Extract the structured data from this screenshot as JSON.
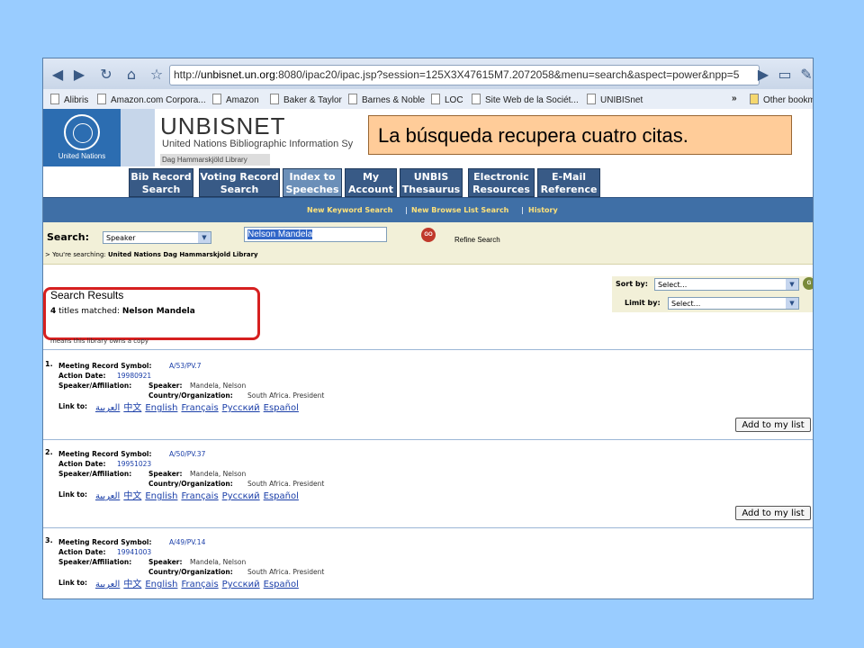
{
  "browser": {
    "url_prefix": "http://",
    "url_host": "unbisnet.un.org",
    "url_rest": ":8080/ipac20/ipac.jsp?session=125X3X47615M7.2072058&menu=search&aspect=power&npp=5",
    "bookmarks": [
      "Alibris",
      "Amazon.com Corpora...",
      "Amazon",
      "Baker & Taylor",
      "Barnes & Noble",
      "LOC",
      "Site Web de la Sociét...",
      "UNIBISnet",
      "Other bookm"
    ],
    "overflow": "»"
  },
  "header": {
    "un_label": "United Nations",
    "title": "UNBISNET",
    "subtitle": "United Nations Bibliographic Information Sy",
    "library": "Dag Hammarskjöld Library"
  },
  "overlay_caption": "La búsqueda recupera cuatro citas.",
  "tabs": [
    {
      "line1": "Bib Record",
      "line2": "Search"
    },
    {
      "line1": "Voting Record",
      "line2": "Search"
    },
    {
      "line1": "Index to",
      "line2": "Speeches"
    },
    {
      "line1": "My",
      "line2": "Account"
    },
    {
      "line1": "UNBIS",
      "line2": "Thesaurus"
    },
    {
      "line1": "Electronic",
      "line2": "Resources"
    },
    {
      "line1": "E-Mail",
      "line2": "Reference"
    }
  ],
  "subnav": [
    "New Keyword Search",
    "New Browse List Search",
    "History"
  ],
  "search": {
    "label": "Search:",
    "field": "Speaker",
    "query": "Nelson Mandela",
    "go": "GO",
    "refine": "Refine Search",
    "searching_prefix": "> You're searching: ",
    "searching_lib": "United Nations Dag Hammarskjold Library"
  },
  "sort": {
    "sort_label": "Sort by:",
    "sort_value": "Select...",
    "limit_label": "Limit by:",
    "limit_value": "Select..."
  },
  "results": {
    "title": "Search Results",
    "count": "4",
    "matched_text": " titles matched: ",
    "query": "Nelson Mandela",
    "legend": "means this library owns a copy"
  },
  "labels": {
    "symbol": "Meeting Record Symbol:",
    "date": "Action Date:",
    "speaker_aff": "Speaker/Affiliation:",
    "speaker": "Speaker:",
    "country": "Country/Organization:",
    "link": "Link to:",
    "add": "Add to my list"
  },
  "languages": [
    "العربية",
    "中文",
    "English",
    "Français",
    "Русский",
    "Español"
  ],
  "records": [
    {
      "num": "1.",
      "symbol": "A/53/PV.7",
      "date": "19980921",
      "speaker": "Mandela, Nelson",
      "country": "South Africa. President"
    },
    {
      "num": "2.",
      "symbol": "A/50/PV.37",
      "date": "19951023",
      "speaker": "Mandela, Nelson",
      "country": "South Africa. President"
    },
    {
      "num": "3.",
      "symbol": "A/49/PV.14",
      "date": "19941003",
      "speaker": "Mandela, Nelson",
      "country": "South Africa. President"
    }
  ]
}
